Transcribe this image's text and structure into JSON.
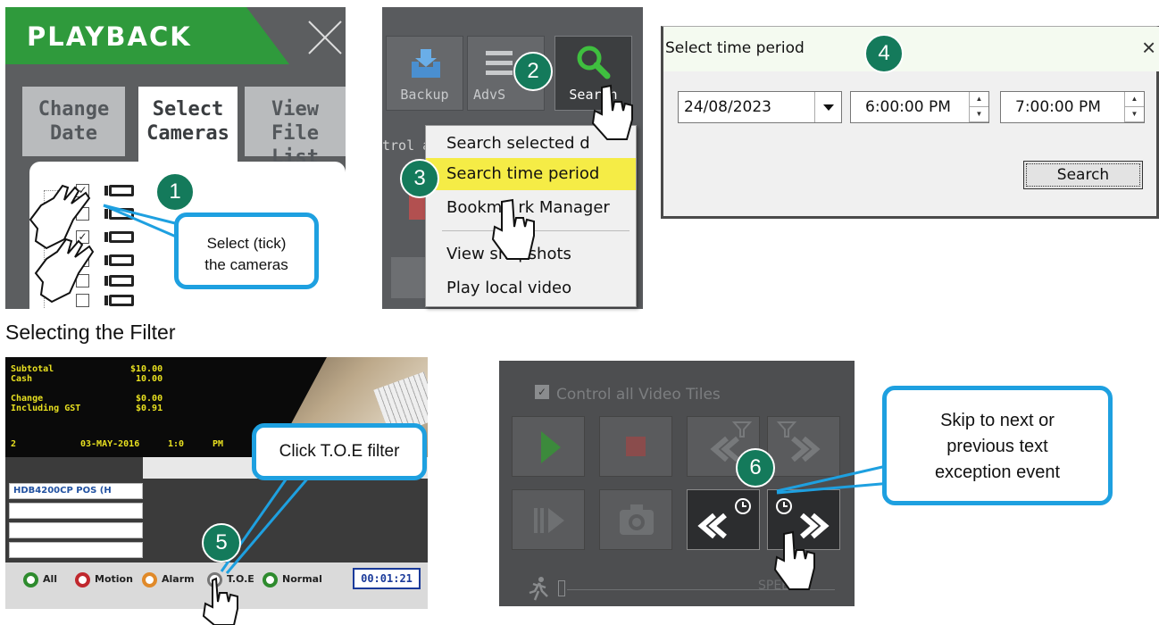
{
  "playback_panel": {
    "title": "PLAYBACK",
    "tabs": [
      "Change Date",
      "Select Cameras",
      "View File List"
    ],
    "tab_lines": [
      [
        "Change",
        "Date"
      ],
      [
        "Select",
        "Cameras"
      ],
      [
        "View",
        "File List"
      ]
    ],
    "selected_tab": "Select Cameras",
    "camera_checkboxes": [
      true,
      false,
      true,
      false,
      false,
      false
    ],
    "callout": "Select (tick) the cameras",
    "callout_lines": [
      "Select (tick)",
      "the cameras"
    ],
    "step": "1"
  },
  "toolbar_panel": {
    "buttons": [
      "Backup",
      "AdvS",
      "Search"
    ],
    "adv_label_visible": "AdvS",
    "control_text": "trol a",
    "menu_items": [
      "Search selected date",
      "Search time period",
      "Bookmark Manager",
      "View snapshots",
      "Play local video"
    ],
    "menu_display": [
      "Search selected d",
      "Search time period",
      "Bookm",
      "rk Manager",
      "View sn",
      "pshots",
      "Play local video"
    ],
    "highlighted_item": "Search time period",
    "step_search": "2",
    "step_menu": "3"
  },
  "dialog": {
    "title": "Select time period",
    "close": "×",
    "date": "24/08/2023",
    "start_time": "6:00:00 PM",
    "end_time": "7:00:00 PM",
    "search_button": "Search",
    "step": "4"
  },
  "heading": "Selecting the Filter",
  "filter_panel": {
    "receipt_lines": [
      [
        "Subtotal",
        "$10.00"
      ],
      [
        "Cash",
        "10.00"
      ],
      [
        "Change",
        "$0.00"
      ],
      [
        "Including GST",
        "$0.91"
      ]
    ],
    "receipt_footer": [
      "2",
      "03-MAY-2016",
      "1:0",
      "PM"
    ],
    "channel_label": "HDB4200CP POS (H",
    "filters": [
      {
        "label": "All",
        "color": "#2e8b2e"
      },
      {
        "label": "Motion",
        "color": "#c0282e"
      },
      {
        "label": "Alarm",
        "color": "#e08a2a"
      },
      {
        "label": "T.O.E",
        "color": "#777777"
      },
      {
        "label": "Normal",
        "color": "#2e8b2e"
      }
    ],
    "time": "00:01:21",
    "callout": "Click T.O.E filter",
    "step": "5"
  },
  "controls_panel": {
    "control_all": "Control all Video Tiles",
    "speed_label": "SPEED",
    "callout": "Skip to next or previous text exception event",
    "callout_lines": [
      "Skip to next or",
      "previous text",
      "exception event"
    ],
    "step": "6"
  }
}
